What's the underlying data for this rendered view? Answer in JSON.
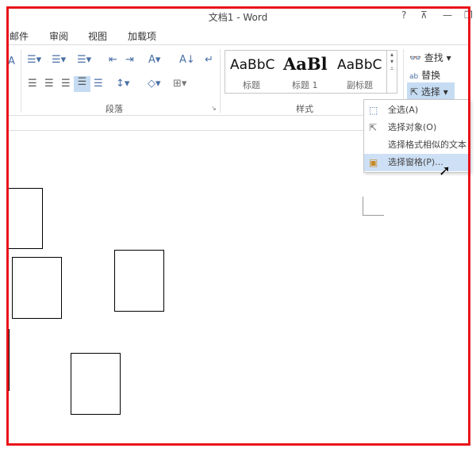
{
  "window": {
    "title": "文档1 - Word",
    "help": "?",
    "ribbon_display": "⊼",
    "minimize": "—",
    "restore": "❐"
  },
  "tabs": [
    "邮件",
    "审阅",
    "视图",
    "加载项"
  ],
  "groups": {
    "paragraph": "段落",
    "styles": "样式"
  },
  "styles": [
    {
      "preview": "AaBbC",
      "label": "标题"
    },
    {
      "preview": "AaBl",
      "label": "标题 1"
    },
    {
      "preview": "AaBbC",
      "label": "副标题"
    }
  ],
  "editing": {
    "find": "查找",
    "replace": "替换",
    "select": "选择"
  },
  "select_menu": [
    {
      "label": "全选(A)",
      "icon": "select-all-icon"
    },
    {
      "label": "选择对象(O)",
      "icon": "cursor-icon"
    },
    {
      "label": "选择格式相似的文本",
      "icon": ""
    },
    {
      "label": "选择窗格(P)...",
      "icon": "selection-pane-icon",
      "highlighted": true
    }
  ],
  "colors": {
    "frame": "#e8141a",
    "highlight": "#cde0f5"
  }
}
